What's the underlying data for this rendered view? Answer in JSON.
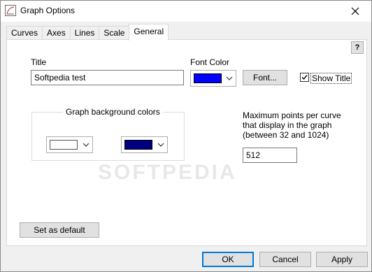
{
  "window": {
    "title": "Graph Options"
  },
  "tabs": [
    {
      "label": "Curves"
    },
    {
      "label": "Axes"
    },
    {
      "label": "Lines"
    },
    {
      "label": "Scale"
    },
    {
      "label": "General"
    }
  ],
  "help": {
    "label": "?"
  },
  "title_field": {
    "label": "Title",
    "value": "Softpedia test"
  },
  "font_color": {
    "label": "Font Color",
    "color": "#0000ff",
    "font_button": "Font..."
  },
  "show_title": {
    "label": "Show Title",
    "checked": true
  },
  "background_group": {
    "title": "Graph background colors",
    "color1": "#ffffff",
    "color2": "#000080"
  },
  "max_points": {
    "label_line1": "Maximum points per curve",
    "label_line2": "that display in the graph",
    "label_line3": "(between 32 and 1024)",
    "value": "512"
  },
  "buttons": {
    "set_default": "Set as default",
    "ok": "OK",
    "cancel": "Cancel",
    "apply": "Apply"
  },
  "watermark": "SOFTPEDIA"
}
